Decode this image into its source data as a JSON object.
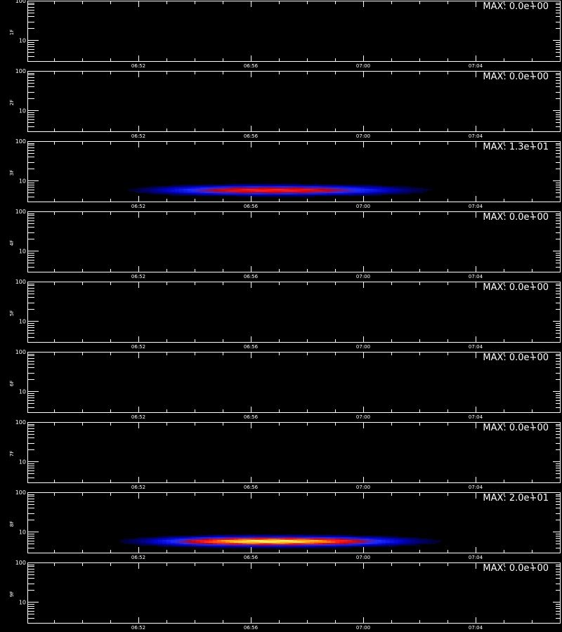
{
  "chart_data": {
    "type": "heatmap",
    "x_tick_labels": [
      "06:52",
      "06:56",
      "07:00",
      "07:04"
    ],
    "y_tick_labels": [
      "100",
      "10"
    ],
    "y_scale": "log",
    "ylim": [
      3,
      100
    ],
    "max_label_prefix": "MAX:",
    "colormap": [
      "#000000",
      "#0000c8",
      "#1e2cff",
      "#c80000",
      "#ff2020",
      "#ffa000",
      "#ffff60"
    ],
    "frame_color": "#ffffff",
    "background_color": "#000000",
    "panels": [
      {
        "label": "1F",
        "max": "0.0e+00",
        "hot": false
      },
      {
        "label": "2F",
        "max": "0.0e+00",
        "hot": false
      },
      {
        "label": "3F",
        "max": "1.3e+01",
        "hot": true,
        "intensity": 0.65
      },
      {
        "label": "4F",
        "max": "0.0e+00",
        "hot": false
      },
      {
        "label": "5F",
        "max": "0.0e+00",
        "hot": false
      },
      {
        "label": "6F",
        "max": "0.0e+00",
        "hot": false
      },
      {
        "label": "7F",
        "max": "0.0e+00",
        "hot": false
      },
      {
        "label": "8F",
        "max": "2.0e+01",
        "hot": true,
        "intensity": 1.0
      },
      {
        "label": "9F",
        "max": "0.0e+00",
        "hot": false
      }
    ]
  }
}
